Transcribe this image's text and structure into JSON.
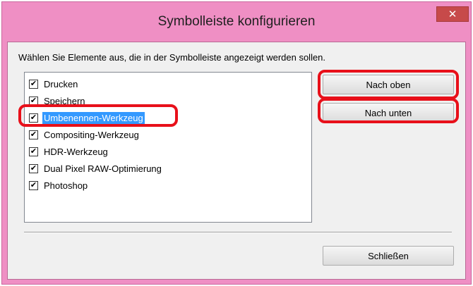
{
  "window": {
    "title": "Symbolleiste konfigurieren",
    "close_glyph": "✕"
  },
  "instruction": "Wählen Sie Elemente aus, die in der Symbolleiste angezeigt werden sollen.",
  "list": {
    "items": [
      {
        "label": "Drucken",
        "checked": true,
        "selected": false
      },
      {
        "label": "Speichern",
        "checked": true,
        "selected": false
      },
      {
        "label": "Umbenennen-Werkzeug",
        "checked": true,
        "selected": true
      },
      {
        "label": "Compositing-Werkzeug",
        "checked": true,
        "selected": false
      },
      {
        "label": "HDR-Werkzeug",
        "checked": true,
        "selected": false
      },
      {
        "label": "Dual Pixel RAW-Optimierung",
        "checked": true,
        "selected": false
      },
      {
        "label": "Photoshop",
        "checked": true,
        "selected": false
      }
    ],
    "check_glyph": "✔"
  },
  "buttons": {
    "up": "Nach oben",
    "down": "Nach unten",
    "close": "Schließen"
  },
  "colors": {
    "titlebar": "#ef8fc4",
    "selection": "#3399ff",
    "highlight": "#e8101a",
    "close_button": "#c74a4a"
  }
}
